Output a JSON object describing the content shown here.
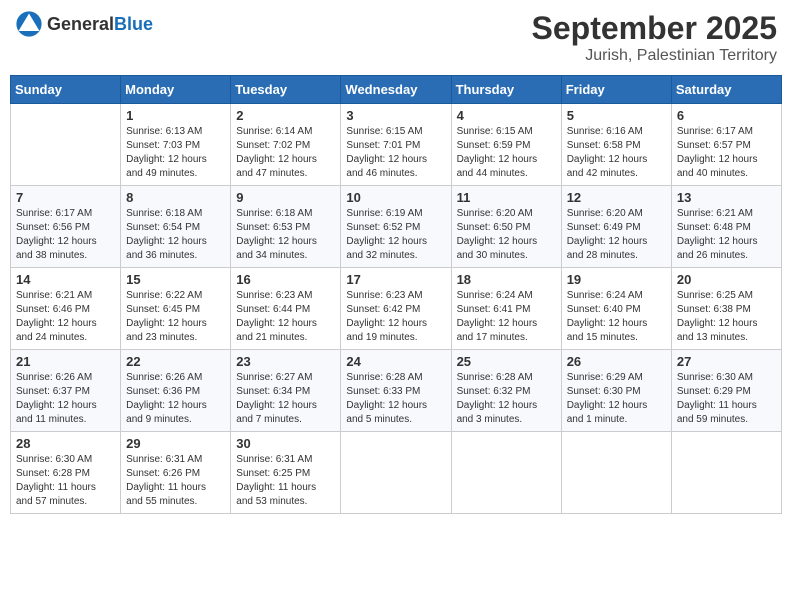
{
  "header": {
    "logo_general": "General",
    "logo_blue": "Blue",
    "month_title": "September 2025",
    "location": "Jurish, Palestinian Territory"
  },
  "days_of_week": [
    "Sunday",
    "Monday",
    "Tuesday",
    "Wednesday",
    "Thursday",
    "Friday",
    "Saturday"
  ],
  "weeks": [
    [
      {
        "day": "",
        "info": ""
      },
      {
        "day": "1",
        "info": "Sunrise: 6:13 AM\nSunset: 7:03 PM\nDaylight: 12 hours\nand 49 minutes."
      },
      {
        "day": "2",
        "info": "Sunrise: 6:14 AM\nSunset: 7:02 PM\nDaylight: 12 hours\nand 47 minutes."
      },
      {
        "day": "3",
        "info": "Sunrise: 6:15 AM\nSunset: 7:01 PM\nDaylight: 12 hours\nand 46 minutes."
      },
      {
        "day": "4",
        "info": "Sunrise: 6:15 AM\nSunset: 6:59 PM\nDaylight: 12 hours\nand 44 minutes."
      },
      {
        "day": "5",
        "info": "Sunrise: 6:16 AM\nSunset: 6:58 PM\nDaylight: 12 hours\nand 42 minutes."
      },
      {
        "day": "6",
        "info": "Sunrise: 6:17 AM\nSunset: 6:57 PM\nDaylight: 12 hours\nand 40 minutes."
      }
    ],
    [
      {
        "day": "7",
        "info": "Sunrise: 6:17 AM\nSunset: 6:56 PM\nDaylight: 12 hours\nand 38 minutes."
      },
      {
        "day": "8",
        "info": "Sunrise: 6:18 AM\nSunset: 6:54 PM\nDaylight: 12 hours\nand 36 minutes."
      },
      {
        "day": "9",
        "info": "Sunrise: 6:18 AM\nSunset: 6:53 PM\nDaylight: 12 hours\nand 34 minutes."
      },
      {
        "day": "10",
        "info": "Sunrise: 6:19 AM\nSunset: 6:52 PM\nDaylight: 12 hours\nand 32 minutes."
      },
      {
        "day": "11",
        "info": "Sunrise: 6:20 AM\nSunset: 6:50 PM\nDaylight: 12 hours\nand 30 minutes."
      },
      {
        "day": "12",
        "info": "Sunrise: 6:20 AM\nSunset: 6:49 PM\nDaylight: 12 hours\nand 28 minutes."
      },
      {
        "day": "13",
        "info": "Sunrise: 6:21 AM\nSunset: 6:48 PM\nDaylight: 12 hours\nand 26 minutes."
      }
    ],
    [
      {
        "day": "14",
        "info": "Sunrise: 6:21 AM\nSunset: 6:46 PM\nDaylight: 12 hours\nand 24 minutes."
      },
      {
        "day": "15",
        "info": "Sunrise: 6:22 AM\nSunset: 6:45 PM\nDaylight: 12 hours\nand 23 minutes."
      },
      {
        "day": "16",
        "info": "Sunrise: 6:23 AM\nSunset: 6:44 PM\nDaylight: 12 hours\nand 21 minutes."
      },
      {
        "day": "17",
        "info": "Sunrise: 6:23 AM\nSunset: 6:42 PM\nDaylight: 12 hours\nand 19 minutes."
      },
      {
        "day": "18",
        "info": "Sunrise: 6:24 AM\nSunset: 6:41 PM\nDaylight: 12 hours\nand 17 minutes."
      },
      {
        "day": "19",
        "info": "Sunrise: 6:24 AM\nSunset: 6:40 PM\nDaylight: 12 hours\nand 15 minutes."
      },
      {
        "day": "20",
        "info": "Sunrise: 6:25 AM\nSunset: 6:38 PM\nDaylight: 12 hours\nand 13 minutes."
      }
    ],
    [
      {
        "day": "21",
        "info": "Sunrise: 6:26 AM\nSunset: 6:37 PM\nDaylight: 12 hours\nand 11 minutes."
      },
      {
        "day": "22",
        "info": "Sunrise: 6:26 AM\nSunset: 6:36 PM\nDaylight: 12 hours\nand 9 minutes."
      },
      {
        "day": "23",
        "info": "Sunrise: 6:27 AM\nSunset: 6:34 PM\nDaylight: 12 hours\nand 7 minutes."
      },
      {
        "day": "24",
        "info": "Sunrise: 6:28 AM\nSunset: 6:33 PM\nDaylight: 12 hours\nand 5 minutes."
      },
      {
        "day": "25",
        "info": "Sunrise: 6:28 AM\nSunset: 6:32 PM\nDaylight: 12 hours\nand 3 minutes."
      },
      {
        "day": "26",
        "info": "Sunrise: 6:29 AM\nSunset: 6:30 PM\nDaylight: 12 hours\nand 1 minute."
      },
      {
        "day": "27",
        "info": "Sunrise: 6:30 AM\nSunset: 6:29 PM\nDaylight: 11 hours\nand 59 minutes."
      }
    ],
    [
      {
        "day": "28",
        "info": "Sunrise: 6:30 AM\nSunset: 6:28 PM\nDaylight: 11 hours\nand 57 minutes."
      },
      {
        "day": "29",
        "info": "Sunrise: 6:31 AM\nSunset: 6:26 PM\nDaylight: 11 hours\nand 55 minutes."
      },
      {
        "day": "30",
        "info": "Sunrise: 6:31 AM\nSunset: 6:25 PM\nDaylight: 11 hours\nand 53 minutes."
      },
      {
        "day": "",
        "info": ""
      },
      {
        "day": "",
        "info": ""
      },
      {
        "day": "",
        "info": ""
      },
      {
        "day": "",
        "info": ""
      }
    ]
  ]
}
